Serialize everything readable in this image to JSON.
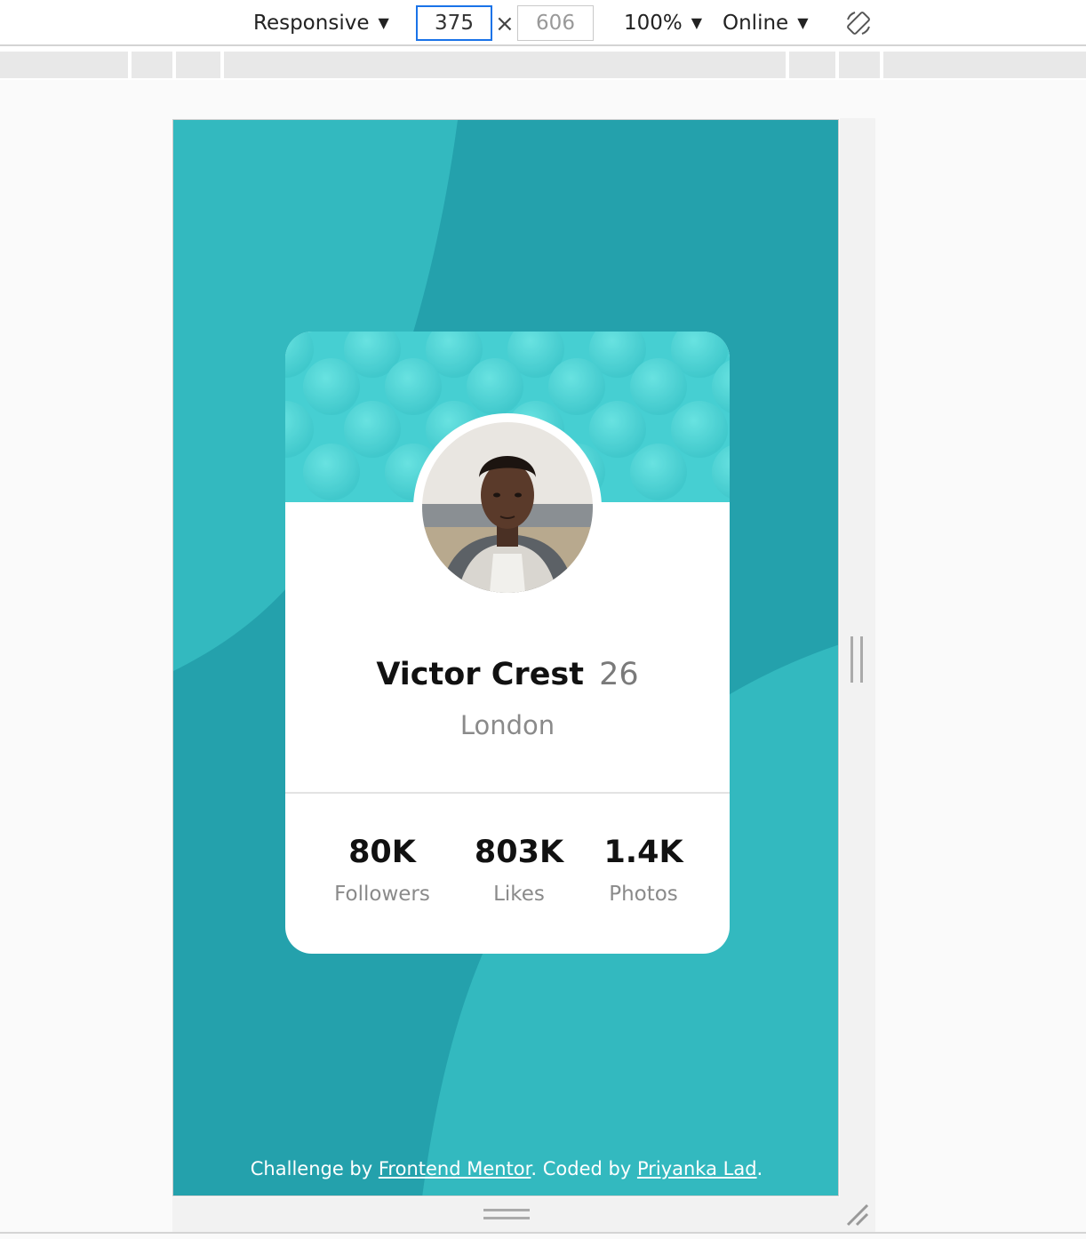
{
  "toolbar": {
    "device": "Responsive",
    "width": "375",
    "height": "606",
    "times": "×",
    "zoom": "100%",
    "network": "Online"
  },
  "profile": {
    "name": "Victor Crest",
    "age": "26",
    "city": "London"
  },
  "stats": [
    {
      "value": "80K",
      "label": "Followers"
    },
    {
      "value": "803K",
      "label": "Likes"
    },
    {
      "value": "1.4K",
      "label": "Photos"
    }
  ],
  "footer": {
    "prefix": "Challenge by ",
    "link1": "Frontend Mentor",
    "middle": ". Coded by ",
    "link2": "Priyanka Lad",
    "suffix": "."
  },
  "colors": {
    "page_bg": "#24a1ac",
    "card_top": "#46cfd2",
    "accent": "#1a73e8"
  }
}
